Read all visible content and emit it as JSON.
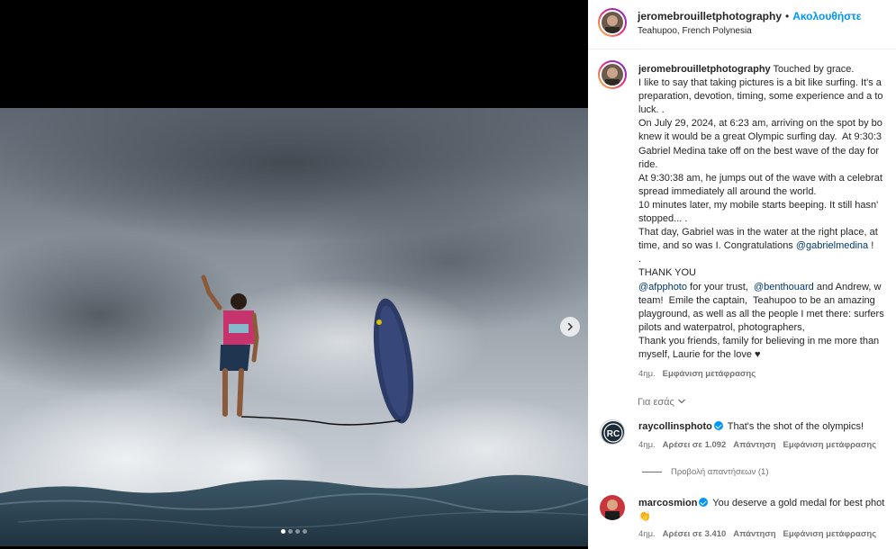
{
  "post": {
    "username": "jeromebrouilletphotography",
    "separator": "•",
    "follow_label": "Ακολουθήστε",
    "location": "Teahupoo, French Polynesia"
  },
  "caption": {
    "username": "jeromebrouilletphotography",
    "first_line": "Touched by grace.",
    "lines": [
      "I like to say that taking pictures is a bit like surfing. It's a",
      "preparation, devotion, timing, some experience and a to",
      "luck. .",
      "On July 29, 2024, at 6:23 am, arriving on the spot by bo",
      "knew it would be a great Olympic surfing day.  At 9:30:3",
      "Gabriel Medina take off on the best wave of the day for",
      "ride.",
      "At 9:30:38 am, he jumps out of the wave with a celebrat",
      "spread immediately all around the world.",
      "10 minutes later, my mobile starts beeping. It still hasn'",
      "stopped... .",
      "That day, Gabriel was in the water at the right place, at",
      "time, and so was I. Congratulations ",
      ".",
      "THANK YOU"
    ],
    "mention_medina": "@gabrielmedina",
    "congrats_tail": " !",
    "thanks_line1_mention": "@afpphoto",
    "thanks_line1_mid": " for your trust,  ",
    "thanks_line1_mention2": "@benthouard",
    "thanks_line1_tail": " and Andrew, w",
    "thanks_lines": [
      "team!  Emile the captain,  Teahupoo to be an amazing",
      "playground, as well as all the people I met there: surfers",
      "pilots and waterpatrol, photographers,",
      "Thank you friends, family for believing in me more than",
      "myself, Laurie for the love ♥"
    ],
    "age": "4ημ.",
    "translate_label": "Εμφάνιση μετάφρασης"
  },
  "for_you_label": "Για εσάς",
  "comments": [
    {
      "username": "raycollinsphoto",
      "text": "That's the shot of the olympics!",
      "age": "4ημ.",
      "likes": "Αρέσει σε 1.092",
      "reply_label": "Απάντηση",
      "translate_label": "Εμφάνιση μετάφρασης",
      "view_replies": "Προβολή απαντήσεων (1)",
      "avatar_text": "RC"
    },
    {
      "username": "marcosmion",
      "text": "You deserve a gold medal for best phot",
      "emoji": "👏",
      "age": "4ημ.",
      "likes": "Αρέσει σε 3.410",
      "reply_label": "Απάντηση",
      "translate_label": "Εμφάνιση μετάφρασης"
    }
  ],
  "carousel": {
    "slides": 4,
    "active": 1
  },
  "colors": {
    "link": "#0095f6",
    "mention": "#00376b",
    "secondary": "#737373"
  },
  "icons": {
    "next": "chevron-right-icon",
    "dropdown": "chevron-down-icon",
    "verified": "verified-badge-icon"
  }
}
